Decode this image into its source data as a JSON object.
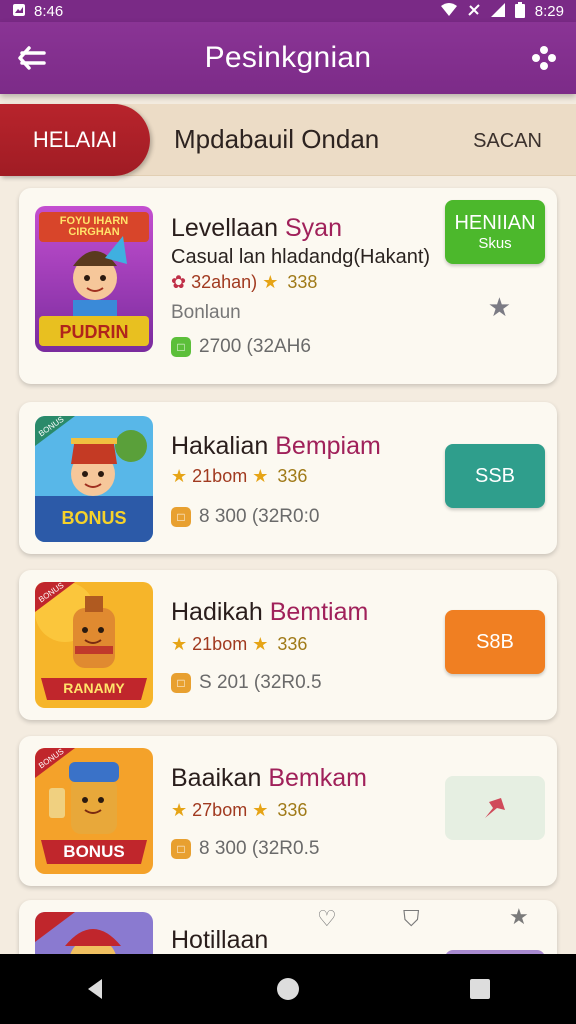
{
  "status": {
    "time_left": "8:46",
    "time_right": "8:29"
  },
  "app_bar": {
    "title": "Pesinkgnian"
  },
  "tabs": {
    "active": "HELAIAI",
    "title": "Mpdabauil Ondan",
    "right": "SACAN"
  },
  "cards": [
    {
      "title": "Levellaan",
      "title_accent": "Syan",
      "subtitle": "Casual lan hladandg(Hakant)",
      "rating_text": "32ahan)",
      "rating_num": "338",
      "extra": "Bonlaun",
      "meta": "2700 (32AH6",
      "button_main": "HENIIAN",
      "button_sub": "Skus",
      "thumb_top": "FOYU IHARN CIRGHAN",
      "thumb_bottom": "PUDRIN"
    },
    {
      "title": "Hakalian",
      "title_accent": "Bempiam",
      "rating_text": "21bom",
      "rating_num": "336",
      "meta": "8 300 (32R0:0",
      "button_main": "SSB",
      "thumb_bottom": "BONUS",
      "thumb_badge": "BONUS"
    },
    {
      "title": "Hadikah",
      "title_accent": "Bemtiam",
      "rating_text": "21bom",
      "rating_num": "336",
      "meta": "S 201 (32R0.5",
      "button_main": "S8B",
      "thumb_bottom": "RANAMY",
      "thumb_badge": "BONUS"
    },
    {
      "title": "Baaikan",
      "title_accent": "Bemkam",
      "rating_text": "27bom",
      "rating_num": "336",
      "meta": "8 300 (32R0.5",
      "thumb_bottom": "BONUS",
      "thumb_badge": "BONUS"
    },
    {
      "title": "Hotillaan"
    }
  ],
  "colors": {
    "app_bar": "#7c2b88",
    "tab_active": "#a01c24",
    "btn_green": "#4cb82c",
    "btn_teal": "#2f9e8c",
    "btn_orange": "#f07f22",
    "btn_pale": "#e6efe2",
    "accent_title": "#a0215a"
  }
}
